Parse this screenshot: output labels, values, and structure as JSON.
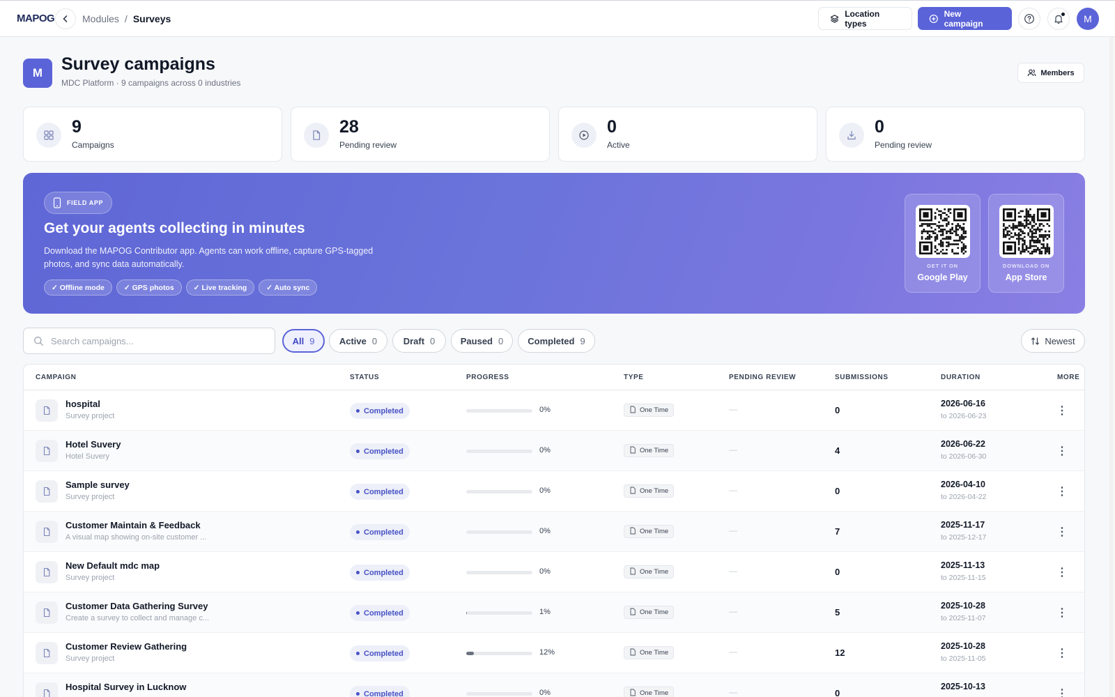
{
  "topbar": {
    "logo": "MAPOG",
    "breadcrumb": [
      "Modules",
      "/",
      "Surveys"
    ],
    "location_types_label": "Location types",
    "new_campaign_label": "New campaign",
    "avatar_letter": "M"
  },
  "header": {
    "avatar_letter": "M",
    "title": "Survey campaigns",
    "subtitle": "MDC Platform · 9 campaigns across 0 industries",
    "members_label": "Members"
  },
  "stats": [
    {
      "value": "9",
      "label": "Campaigns",
      "icon": "grid-icon"
    },
    {
      "value": "28",
      "label": "Pending review",
      "icon": "document-icon"
    },
    {
      "value": "0",
      "label": "Active",
      "icon": "play-icon"
    },
    {
      "value": "0",
      "label": "Pending review",
      "icon": "download-icon"
    }
  ],
  "banner": {
    "pill": "FIELD APP",
    "title": "Get your agents collecting in minutes",
    "description": "Download the MAPOG Contributor app. Agents can work offline, capture GPS-tagged photos, and sync data automatically.",
    "features": [
      "✓ Offline mode",
      "✓ GPS photos",
      "✓ Live tracking",
      "✓ Auto sync"
    ],
    "stores": [
      {
        "small": "GET IT ON",
        "big": "Google Play"
      },
      {
        "small": "DOWNLOAD ON",
        "big": "App Store"
      }
    ]
  },
  "filters": {
    "search_placeholder": "Search campaigns...",
    "chips": [
      {
        "label": "All",
        "count": "9"
      },
      {
        "label": "Active",
        "count": "0"
      },
      {
        "label": "Draft",
        "count": "0"
      },
      {
        "label": "Paused",
        "count": "0"
      },
      {
        "label": "Completed",
        "count": "9"
      }
    ],
    "sort_label": "Newest"
  },
  "table": {
    "columns": [
      "CAMPAIGN",
      "STATUS",
      "PROGRESS",
      "TYPE",
      "PENDING REVIEW",
      "SUBMISSIONS",
      "DURATION",
      "MORE"
    ],
    "rows": [
      {
        "name": "hospital",
        "desc": "Survey project",
        "status": "Completed",
        "progress": 0,
        "progress_text": "0%",
        "type": "One Time",
        "pending": "—",
        "submissions": "0",
        "start": "2026-06-16",
        "end": "to 2026-06-23"
      },
      {
        "name": "Hotel Suvery",
        "desc": "Hotel Suvery",
        "status": "Completed",
        "progress": 0,
        "progress_text": "0%",
        "type": "One Time",
        "pending": "—",
        "submissions": "4",
        "start": "2026-06-22",
        "end": "to 2026-06-30"
      },
      {
        "name": "Sample survey",
        "desc": "Survey project",
        "status": "Completed",
        "progress": 0,
        "progress_text": "0%",
        "type": "One Time",
        "pending": "—",
        "submissions": "0",
        "start": "2026-04-10",
        "end": "to 2026-04-22"
      },
      {
        "name": "Customer Maintain & Feedback",
        "desc": "A visual map showing on-site customer ...",
        "status": "Completed",
        "progress": 0,
        "progress_text": "0%",
        "type": "One Time",
        "pending": "—",
        "submissions": "7",
        "start": "2025-11-17",
        "end": "to 2025-12-17"
      },
      {
        "name": "New Default mdc map",
        "desc": "Survey project",
        "status": "Completed",
        "progress": 0,
        "progress_text": "0%",
        "type": "One Time",
        "pending": "—",
        "submissions": "0",
        "start": "2025-11-13",
        "end": "to 2025-11-15"
      },
      {
        "name": "Customer Data Gathering Survey",
        "desc": "Create a survey to collect and manage c...",
        "status": "Completed",
        "progress": 1,
        "progress_text": "1%",
        "type": "One Time",
        "pending": "—",
        "submissions": "5",
        "start": "2025-10-28",
        "end": "to 2025-11-07"
      },
      {
        "name": "Customer Review Gathering",
        "desc": "Survey project",
        "status": "Completed",
        "progress": 12,
        "progress_text": "12%",
        "type": "One Time",
        "pending": "—",
        "submissions": "12",
        "start": "2025-10-28",
        "end": "to 2025-11-05"
      },
      {
        "name": "Hospital Survey in Lucknow",
        "desc": "",
        "status": "Completed",
        "progress": 0,
        "progress_text": "0%",
        "type": "One Time",
        "pending": "—",
        "submissions": "0",
        "start": "2025-10-13",
        "end": ""
      }
    ]
  },
  "colors": {
    "accent": "#5b63d8",
    "status_text": "#4752c4",
    "status_bg": "#edeff9"
  }
}
